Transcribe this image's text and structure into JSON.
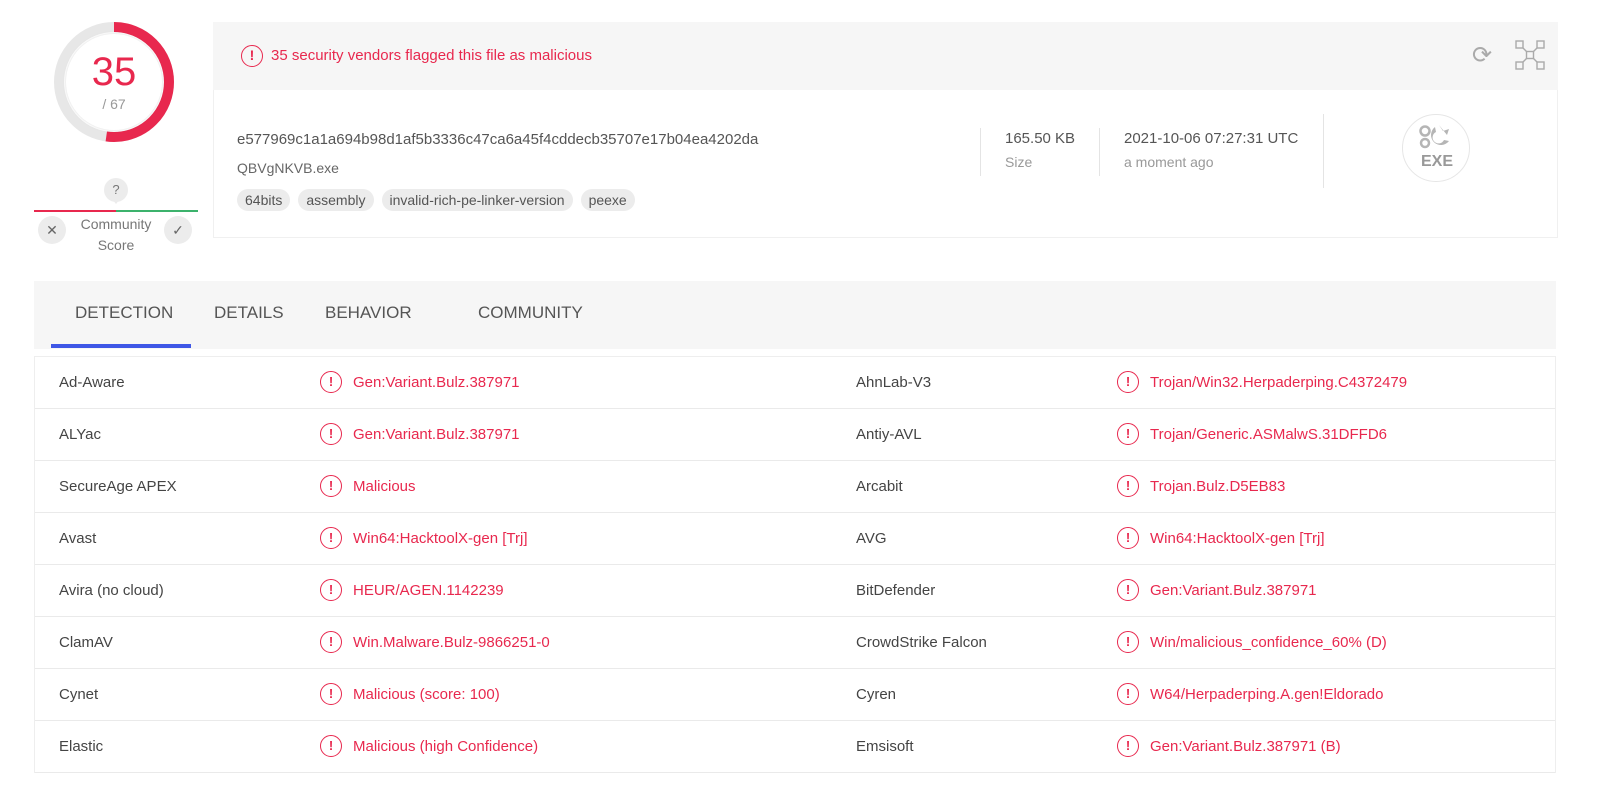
{
  "score": {
    "detected": "35",
    "total": "/ 67",
    "ratio": 0.522,
    "color_flagged": "#e8284e",
    "color_track": "#e7e7e7"
  },
  "community": {
    "question": "?",
    "label_line1": "Community",
    "label_line2": "Score",
    "down_icon": "close-icon",
    "up_icon": "check-icon"
  },
  "alert": {
    "text": "35 security vendors flagged this file as malicious",
    "icon": "!"
  },
  "file": {
    "hash": "e577969c1a1a694b98d1af5b3336c47ca6a45f4cddecb35707e17b04ea4202da",
    "name": "QBVgNKVB.exe",
    "tags": [
      "64bits",
      "assembly",
      "invalid-rich-pe-linker-version",
      "peexe"
    ],
    "size_value": "165.50 KB",
    "size_label": "Size",
    "date_value": "2021-10-06 07:27:31 UTC",
    "date_label": "a moment ago",
    "type_badge": "EXE"
  },
  "tabs": [
    {
      "label": "DETECTION",
      "active": true
    },
    {
      "label": "DETAILS",
      "active": false
    },
    {
      "label": "BEHAVIOR",
      "active": false
    },
    {
      "label": "COMMUNITY",
      "active": false
    }
  ],
  "detections": [
    {
      "left_vendor": "Ad-Aware",
      "left_result": "Gen:Variant.Bulz.387971",
      "right_vendor": "AhnLab-V3",
      "right_result": "Trojan/Win32.Herpaderping.C4372479"
    },
    {
      "left_vendor": "ALYac",
      "left_result": "Gen:Variant.Bulz.387971",
      "right_vendor": "Antiy-AVL",
      "right_result": "Trojan/Generic.ASMalwS.31DFFD6"
    },
    {
      "left_vendor": "SecureAge APEX",
      "left_result": "Malicious",
      "right_vendor": "Arcabit",
      "right_result": "Trojan.Bulz.D5EB83"
    },
    {
      "left_vendor": "Avast",
      "left_result": "Win64:HacktoolX-gen [Trj]",
      "right_vendor": "AVG",
      "right_result": "Win64:HacktoolX-gen [Trj]"
    },
    {
      "left_vendor": "Avira (no cloud)",
      "left_result": "HEUR/AGEN.1142239",
      "right_vendor": "BitDefender",
      "right_result": "Gen:Variant.Bulz.387971"
    },
    {
      "left_vendor": "ClamAV",
      "left_result": "Win.Malware.Bulz-9866251-0",
      "right_vendor": "CrowdStrike Falcon",
      "right_result": "Win/malicious_confidence_60% (D)"
    },
    {
      "left_vendor": "Cynet",
      "left_result": "Malicious (score: 100)",
      "right_vendor": "Cyren",
      "right_result": "W64/Herpaderping.A.gen!Eldorado"
    },
    {
      "left_vendor": "Elastic",
      "left_result": "Malicious (high Confidence)",
      "right_vendor": "Emsisoft",
      "right_result": "Gen:Variant.Bulz.387971 (B)"
    }
  ]
}
